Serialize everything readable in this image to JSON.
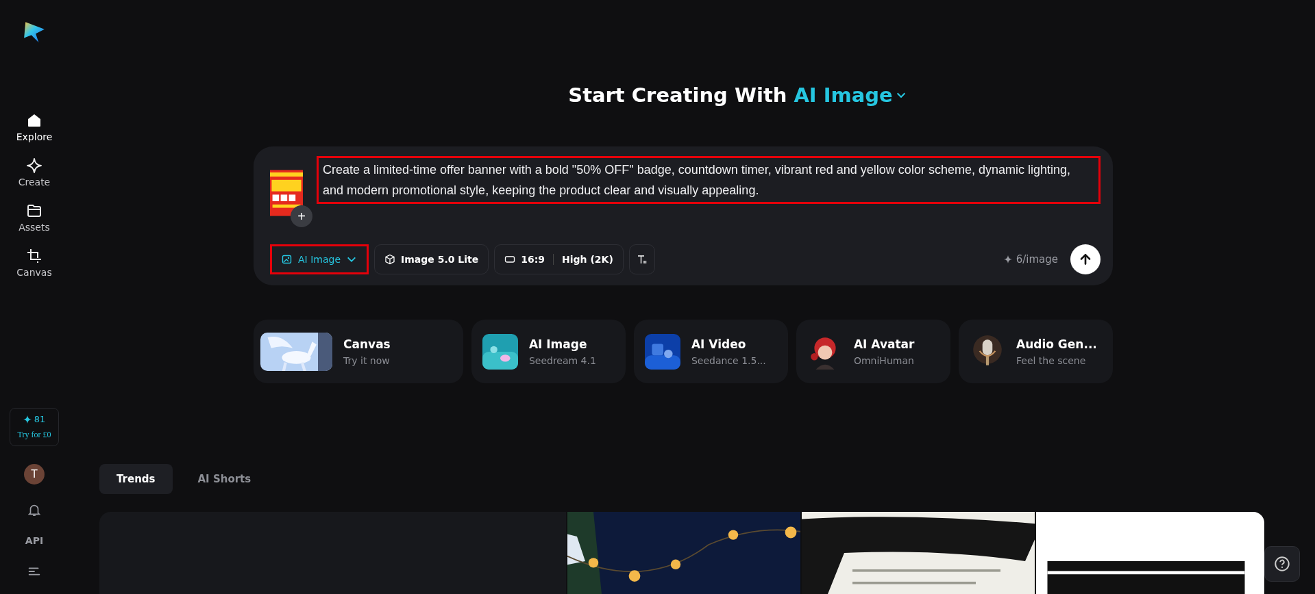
{
  "sidebar": {
    "items": [
      {
        "label": "Explore",
        "kind": "home",
        "selected": true
      },
      {
        "label": "Create",
        "kind": "create",
        "selected": false
      },
      {
        "label": "Assets",
        "kind": "assets",
        "selected": false
      },
      {
        "label": "Canvas",
        "kind": "canvas",
        "selected": false
      }
    ],
    "credits": {
      "amount": "81",
      "offer": "Try for £0"
    },
    "avatar": "T",
    "api": "API"
  },
  "heading": {
    "text": "Start Creating With",
    "mode": "AI Image"
  },
  "prompt": {
    "value": "Create a limited-time offer banner with a bold \"50% OFF\" badge, countdown timer, vibrant red and yellow color scheme, dynamic lighting, and modern promotional style, keeping the product clear and visually appealing.",
    "highlighted": true,
    "attach": "+",
    "toolbar": [
      {
        "kind": "mode",
        "label": "AI Image",
        "highlighted": true
      },
      {
        "kind": "model",
        "label": "Image 5.0 Lite",
        "highlighted": false
      },
      {
        "kind": "ratio",
        "label": "16:9",
        "extra": "High (2K)",
        "highlighted": false
      },
      {
        "kind": "text",
        "highlighted": false
      }
    ],
    "cost": "6/image"
  },
  "shortcuts": [
    {
      "title": "Canvas",
      "subtitle": "Try it now",
      "kind": "pegasus"
    },
    {
      "title": "AI Image",
      "subtitle": "Seedream 4.1",
      "kind": "teal"
    },
    {
      "title": "AI Video",
      "subtitle": "Seedance 1.5...",
      "kind": "blue"
    },
    {
      "title": "AI Avatar",
      "subtitle": "OmniHuman",
      "kind": "avatar"
    },
    {
      "title": "Audio Gen...",
      "subtitle": "Feel the scene",
      "kind": "mic"
    }
  ],
  "tabs": [
    {
      "label": "Trends",
      "selected": true
    },
    {
      "label": "AI Shorts",
      "selected": false
    }
  ]
}
